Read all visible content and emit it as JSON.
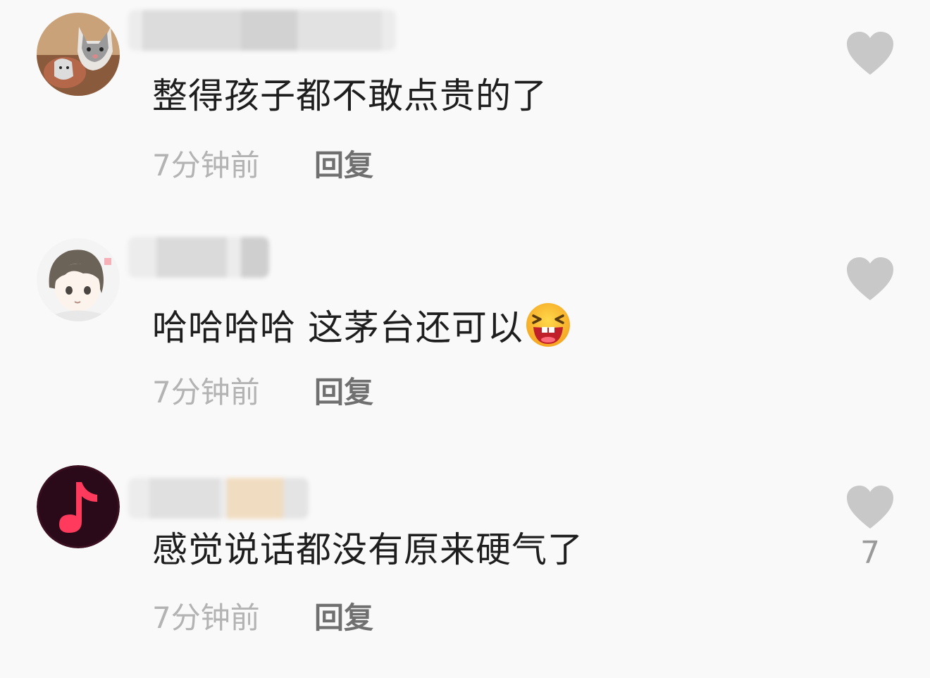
{
  "comments": [
    {
      "avatar_icon": "cat-avatar",
      "username_state": "blurred",
      "text": "整得孩子都不敢点贵的了",
      "time": "7分钟前",
      "reply_label": "回复",
      "like_icon": "heart-icon",
      "like_count": ""
    },
    {
      "avatar_icon": "anime-boy-avatar",
      "username_state": "blurred",
      "text": "哈哈哈哈 这茅台还可以",
      "emoji": "laughing-emoji",
      "time": "7分钟前",
      "reply_label": "回复",
      "like_icon": "heart-icon",
      "like_count": ""
    },
    {
      "avatar_icon": "music-note-avatar",
      "username_state": "blurred",
      "text": "感觉说话都没有原来硬气了",
      "time": "7分钟前",
      "reply_label": "回复",
      "like_icon": "heart-icon",
      "like_count": "7"
    }
  ],
  "colors": {
    "background": "#f9f9f9",
    "text": "#1e1e1e",
    "time": "#b3b3b3",
    "reply": "#707070",
    "heart": "#c8c8c8",
    "music_avatar_bg": "#3a1020",
    "music_note": "#ff3a5c"
  }
}
